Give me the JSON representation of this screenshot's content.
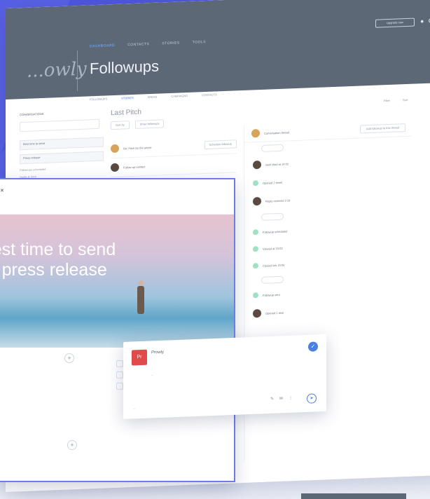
{
  "app": {
    "brand": "...owly",
    "page_title": "Followups",
    "nav": [
      "DASHBOARD",
      "CONTACTS",
      "STORIES",
      "TOOLS"
    ],
    "header_button": "Upgrade now",
    "subtabs": [
      "FOLLOWUPS",
      "STORIES",
      "PRESS",
      "CAMPAIGNS",
      "CONTACTS"
    ]
  },
  "sidebar": {
    "title": "CONVERSATIONS",
    "items": [
      "Best time to send",
      "Press release"
    ],
    "lines": [
      "Followups scheduled",
      "Drafts & Sent",
      "Notes"
    ]
  },
  "list": {
    "title": "Last Pitch",
    "filters": [
      "Sort by",
      "Show followups"
    ],
    "cards": [
      {
        "text": "Re: Pitch for the article",
        "button": "Schedule followup"
      },
      {
        "text": "Follow-up contact"
      }
    ]
  },
  "toolbar_right": [
    "Filter",
    "Sort"
  ],
  "thread": {
    "header_text": "Conversation thread",
    "header_button": "Add followup to this thread",
    "rows": [
      "Sent Wed at 14:02",
      "Opened 2 times",
      "Reply received 2:18",
      "Followup scheduled",
      "Viewed at 15:03",
      "Clicked link 15:05",
      "Followup sent",
      "Opened 1 time"
    ]
  },
  "overlay": {
    "hero_title_1": "e best time to send",
    "hero_title_2": "ut a press release",
    "hero_sub_1": "...",
    "hero_sub_2": "...",
    "article_p1": "...",
    "article_p2": "..."
  },
  "popup": {
    "logo_text": "Pr",
    "title": "Prowly",
    "body": "...",
    "footer": "..."
  }
}
